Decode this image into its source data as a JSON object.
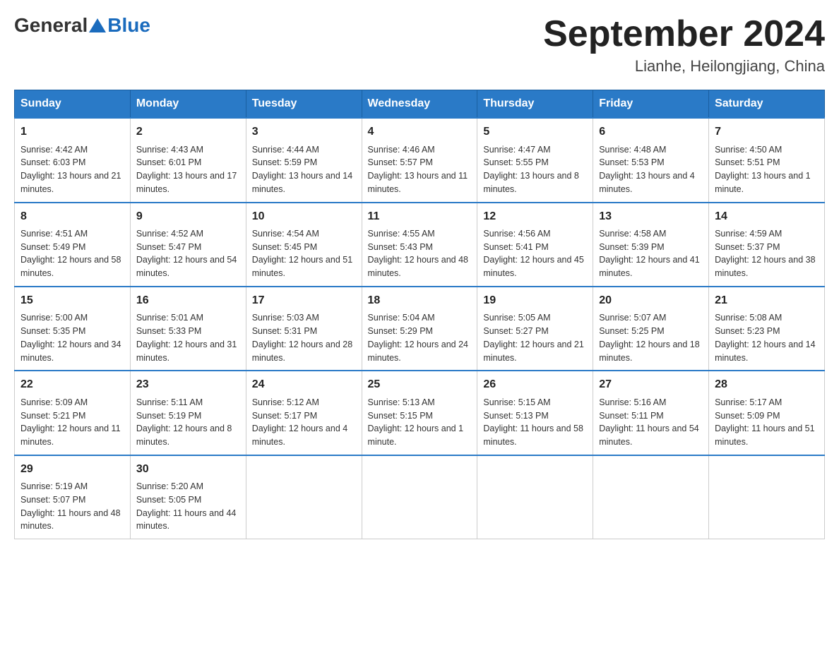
{
  "logo": {
    "general": "General",
    "blue": "Blue"
  },
  "title": "September 2024",
  "location": "Lianhe, Heilongjiang, China",
  "days_of_week": [
    "Sunday",
    "Monday",
    "Tuesday",
    "Wednesday",
    "Thursday",
    "Friday",
    "Saturday"
  ],
  "weeks": [
    [
      {
        "day": "1",
        "sunrise": "4:42 AM",
        "sunset": "6:03 PM",
        "daylight": "13 hours and 21 minutes."
      },
      {
        "day": "2",
        "sunrise": "4:43 AM",
        "sunset": "6:01 PM",
        "daylight": "13 hours and 17 minutes."
      },
      {
        "day": "3",
        "sunrise": "4:44 AM",
        "sunset": "5:59 PM",
        "daylight": "13 hours and 14 minutes."
      },
      {
        "day": "4",
        "sunrise": "4:46 AM",
        "sunset": "5:57 PM",
        "daylight": "13 hours and 11 minutes."
      },
      {
        "day": "5",
        "sunrise": "4:47 AM",
        "sunset": "5:55 PM",
        "daylight": "13 hours and 8 minutes."
      },
      {
        "day": "6",
        "sunrise": "4:48 AM",
        "sunset": "5:53 PM",
        "daylight": "13 hours and 4 minutes."
      },
      {
        "day": "7",
        "sunrise": "4:50 AM",
        "sunset": "5:51 PM",
        "daylight": "13 hours and 1 minute."
      }
    ],
    [
      {
        "day": "8",
        "sunrise": "4:51 AM",
        "sunset": "5:49 PM",
        "daylight": "12 hours and 58 minutes."
      },
      {
        "day": "9",
        "sunrise": "4:52 AM",
        "sunset": "5:47 PM",
        "daylight": "12 hours and 54 minutes."
      },
      {
        "day": "10",
        "sunrise": "4:54 AM",
        "sunset": "5:45 PM",
        "daylight": "12 hours and 51 minutes."
      },
      {
        "day": "11",
        "sunrise": "4:55 AM",
        "sunset": "5:43 PM",
        "daylight": "12 hours and 48 minutes."
      },
      {
        "day": "12",
        "sunrise": "4:56 AM",
        "sunset": "5:41 PM",
        "daylight": "12 hours and 45 minutes."
      },
      {
        "day": "13",
        "sunrise": "4:58 AM",
        "sunset": "5:39 PM",
        "daylight": "12 hours and 41 minutes."
      },
      {
        "day": "14",
        "sunrise": "4:59 AM",
        "sunset": "5:37 PM",
        "daylight": "12 hours and 38 minutes."
      }
    ],
    [
      {
        "day": "15",
        "sunrise": "5:00 AM",
        "sunset": "5:35 PM",
        "daylight": "12 hours and 34 minutes."
      },
      {
        "day": "16",
        "sunrise": "5:01 AM",
        "sunset": "5:33 PM",
        "daylight": "12 hours and 31 minutes."
      },
      {
        "day": "17",
        "sunrise": "5:03 AM",
        "sunset": "5:31 PM",
        "daylight": "12 hours and 28 minutes."
      },
      {
        "day": "18",
        "sunrise": "5:04 AM",
        "sunset": "5:29 PM",
        "daylight": "12 hours and 24 minutes."
      },
      {
        "day": "19",
        "sunrise": "5:05 AM",
        "sunset": "5:27 PM",
        "daylight": "12 hours and 21 minutes."
      },
      {
        "day": "20",
        "sunrise": "5:07 AM",
        "sunset": "5:25 PM",
        "daylight": "12 hours and 18 minutes."
      },
      {
        "day": "21",
        "sunrise": "5:08 AM",
        "sunset": "5:23 PM",
        "daylight": "12 hours and 14 minutes."
      }
    ],
    [
      {
        "day": "22",
        "sunrise": "5:09 AM",
        "sunset": "5:21 PM",
        "daylight": "12 hours and 11 minutes."
      },
      {
        "day": "23",
        "sunrise": "5:11 AM",
        "sunset": "5:19 PM",
        "daylight": "12 hours and 8 minutes."
      },
      {
        "day": "24",
        "sunrise": "5:12 AM",
        "sunset": "5:17 PM",
        "daylight": "12 hours and 4 minutes."
      },
      {
        "day": "25",
        "sunrise": "5:13 AM",
        "sunset": "5:15 PM",
        "daylight": "12 hours and 1 minute."
      },
      {
        "day": "26",
        "sunrise": "5:15 AM",
        "sunset": "5:13 PM",
        "daylight": "11 hours and 58 minutes."
      },
      {
        "day": "27",
        "sunrise": "5:16 AM",
        "sunset": "5:11 PM",
        "daylight": "11 hours and 54 minutes."
      },
      {
        "day": "28",
        "sunrise": "5:17 AM",
        "sunset": "5:09 PM",
        "daylight": "11 hours and 51 minutes."
      }
    ],
    [
      {
        "day": "29",
        "sunrise": "5:19 AM",
        "sunset": "5:07 PM",
        "daylight": "11 hours and 48 minutes."
      },
      {
        "day": "30",
        "sunrise": "5:20 AM",
        "sunset": "5:05 PM",
        "daylight": "11 hours and 44 minutes."
      },
      null,
      null,
      null,
      null,
      null
    ]
  ]
}
